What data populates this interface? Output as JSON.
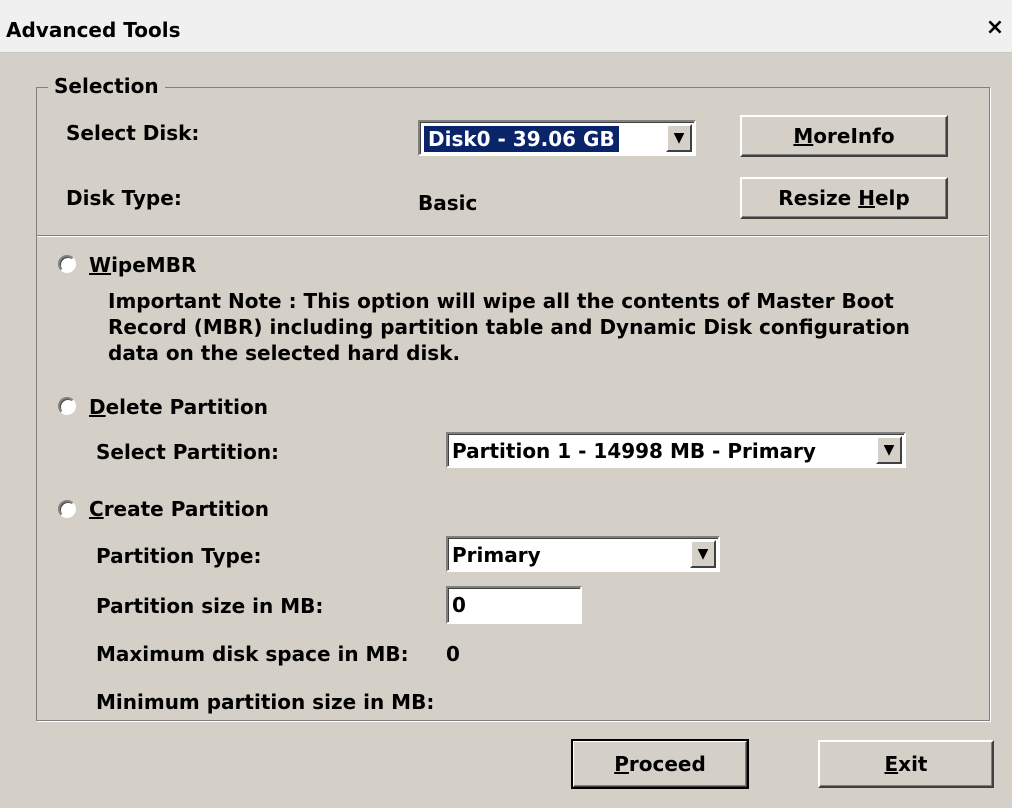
{
  "window": {
    "title": "Advanced Tools",
    "close_glyph": "×"
  },
  "selection": {
    "legend": "Selection",
    "select_disk_label": "Select Disk:",
    "disk_value": "Disk0 - 39.06 GB",
    "disk_type_label": "Disk Type:",
    "disk_type_value": "Basic",
    "moreinfo_button": {
      "mnemonic": "M",
      "rest": "oreInfo"
    },
    "resize_help_button": {
      "pre": "Resize ",
      "mnemonic": "H",
      "rest": "elp"
    }
  },
  "wipembr": {
    "label": {
      "mnemonic": "W",
      "rest": "ipeMBR"
    },
    "note": "Important Note : This option will wipe all the contents of Master Boot Record (MBR) including partition table and Dynamic Disk configuration data on the selected hard disk."
  },
  "delete_partition": {
    "label": {
      "mnemonic": "D",
      "rest": "elete Partition"
    },
    "select_partition_label": "Select Partition:",
    "partition_value": "Partition 1 - 14998 MB - Primary"
  },
  "create_partition": {
    "label": {
      "mnemonic": "C",
      "rest": "reate Partition"
    },
    "partition_type_label": "Partition Type:",
    "partition_type_value": "Primary",
    "partition_size_label": "Partition size in MB:",
    "partition_size_value": "0",
    "max_space_label": "Maximum disk space in MB:",
    "max_space_value": "0",
    "min_size_label": "Minimum partition size in MB:"
  },
  "footer": {
    "proceed_button": {
      "mnemonic": "P",
      "rest": "roceed"
    },
    "exit_button": {
      "mnemonic": "E",
      "rest": "xit"
    }
  },
  "icons": {
    "dropdown": "dropdown-arrow-icon",
    "close": "close-icon"
  }
}
